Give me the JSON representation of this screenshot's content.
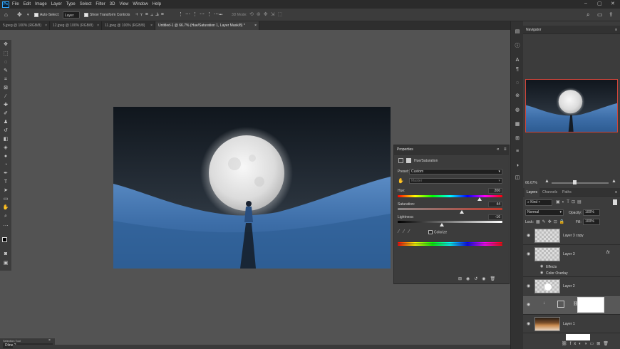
{
  "menu": [
    "File",
    "Edit",
    "Image",
    "Layer",
    "Type",
    "Select",
    "Filter",
    "3D",
    "View",
    "Window",
    "Help"
  ],
  "logo": "Ps",
  "options": {
    "auto_select": "Auto-Select:",
    "layer_dropdown": "Layer",
    "transform_controls": "Show Transform Controls",
    "mode_3d": "3D Mode:",
    "more": "•••"
  },
  "tabs": [
    {
      "label": "5.jpeg @ 100% (RGB/8)",
      "close": "×"
    },
    {
      "label": "12.jpeg @ 100% (RGB/8)",
      "close": "×"
    },
    {
      "label": "11.jpeg @ 100% (RGB/8)",
      "close": "×"
    },
    {
      "label": "Untitled-1 @ 66.7% (Hue/Saturation 1, Layer Mask/8) *",
      "close": "×"
    }
  ],
  "properties": {
    "title": "Properties",
    "adjustment": "Hue/Saturation",
    "preset_label": "Preset:",
    "preset_value": "Custom",
    "channel_value": "Master",
    "hue_label": "Hue:",
    "hue_value": "206",
    "hue_fraction": 0.78,
    "saturation_label": "Saturation:",
    "saturation_value": "44",
    "saturation_fraction": 0.61,
    "lightness_label": "Lightness:",
    "lightness_value": "-16",
    "lightness_fraction": 0.42,
    "colorize_label": "Colorize"
  },
  "navigator": {
    "title": "Navigator",
    "zoom": "66.67%"
  },
  "layers_panel": {
    "tabs": [
      "Layers",
      "Channels",
      "Paths"
    ],
    "kind": "Kind",
    "blend_mode": "Normal",
    "opacity_label": "Opacity:",
    "opacity_value": "100%",
    "lock_label": "Lock:",
    "fill_label": "Fill:",
    "fill_value": "100%",
    "layers": [
      {
        "name": "Layer 3 copy"
      },
      {
        "name": "Layer 3",
        "fx": "fx"
      },
      {
        "name": "Effects"
      },
      {
        "name": "Color Overlay"
      },
      {
        "name": "Layer 2"
      },
      {
        "name": ""
      },
      {
        "name": "Layer 1"
      }
    ]
  },
  "selection_tool": {
    "title": "Selection Tool",
    "value": "Dline 2"
  }
}
